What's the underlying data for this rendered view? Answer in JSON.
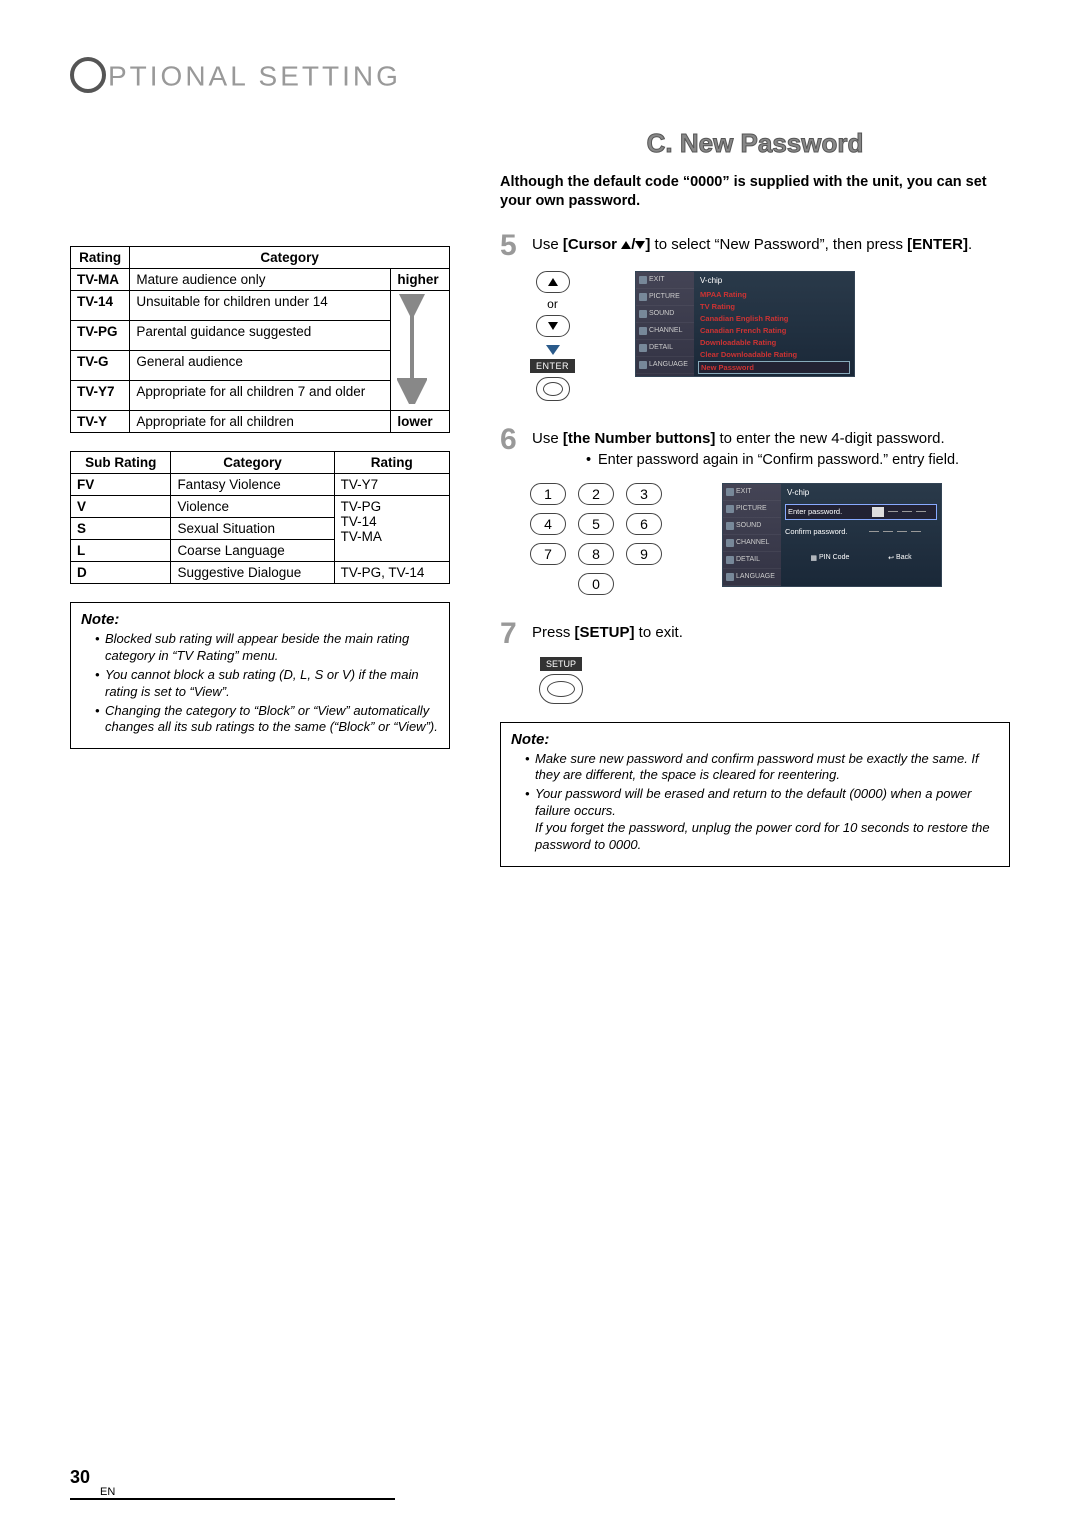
{
  "page": {
    "header": "PTIONAL   SETTING",
    "number": "30",
    "lang": "EN"
  },
  "section": {
    "prefix": "C.",
    "title": "New Password"
  },
  "intro": "Although the default code “0000” is supplied with the unit, you can set your own password.",
  "rating_table": {
    "headers": {
      "c1": "Rating",
      "c2": "Category",
      "top": "higher",
      "bottom": "lower"
    },
    "rows": [
      {
        "r": "TV-MA",
        "c": "Mature audience only"
      },
      {
        "r": "TV-14",
        "c": "Unsuitable for children under 14"
      },
      {
        "r": "TV-PG",
        "c": "Parental guidance suggested"
      },
      {
        "r": "TV-G",
        "c": "General audience"
      },
      {
        "r": "TV-Y7",
        "c": "Appropriate for all children 7 and older"
      },
      {
        "r": "TV-Y",
        "c": "Appropriate for all children"
      }
    ]
  },
  "sub_table": {
    "headers": {
      "c1": "Sub Rating",
      "c2": "Category",
      "c3": "Rating"
    },
    "rows": [
      {
        "s": "FV",
        "c": "Fantasy Violence",
        "r": "TV-Y7"
      },
      {
        "s": "V",
        "c": "Violence",
        "r": ""
      },
      {
        "s": "S",
        "c": "Sexual Situation",
        "r": ""
      },
      {
        "s": "L",
        "c": "Coarse Language",
        "r": ""
      },
      {
        "s": "D",
        "c": "Suggestive Dialogue",
        "r": "TV-PG, TV-14"
      }
    ],
    "merged_r": "TV-PG\nTV-14\nTV-MA"
  },
  "left_note": {
    "title": "Note:",
    "items": [
      "Blocked sub rating will appear beside the main rating category in “TV Rating” menu.",
      "You cannot block a sub rating (D, L, S or V) if the main rating is set to “View”.",
      "Changing the category to “Block” or “View” automatically changes all its sub ratings to the same (“Block” or “View”)."
    ]
  },
  "steps": {
    "s5": {
      "num": "5",
      "pre": "Use ",
      "btn": "[Cursor ",
      "post": "] ",
      "tail": "to select “New Password”, then press ",
      "enter": "[ENTER]",
      "dot": "."
    },
    "s6": {
      "num": "6",
      "pre": "Use ",
      "btn": "[the Number buttons]",
      "tail": " to enter the new 4-digit password.",
      "bullet": "Enter password again in “Confirm password.” entry field."
    },
    "s7": {
      "num": "7",
      "text_pre": "Press ",
      "btn": "[SETUP]",
      "text_post": " to exit."
    }
  },
  "remote": {
    "or": "or",
    "enter": "ENTER",
    "setup": "SETUP",
    "digits": [
      "1",
      "2",
      "3",
      "4",
      "5",
      "6",
      "7",
      "8",
      "9",
      "0"
    ]
  },
  "osd": {
    "left_items": [
      "EXIT",
      "PICTURE",
      "SOUND",
      "CHANNEL",
      "DETAIL",
      "LANGUAGE"
    ],
    "vchip_title": "V-chip",
    "menu": [
      "MPAA Rating",
      "TV Rating",
      "Canadian English Rating",
      "Canadian French Rating",
      "Downloadable Rating",
      "Clear Downloadable Rating",
      "New Password"
    ],
    "enter_pw": "Enter password.",
    "confirm_pw": "Confirm password.",
    "pin": "PIN Code",
    "back": "Back"
  },
  "right_note": {
    "title": "Note:",
    "items": [
      "Make sure new password and confirm password must be exactly the same. If they are different, the space is cleared for reentering.",
      "Your password will be erased and return to the default (0000) when a power failure occurs."
    ],
    "sub": "If you forget the password, unplug the power cord for 10 seconds to restore the password to 0000."
  }
}
